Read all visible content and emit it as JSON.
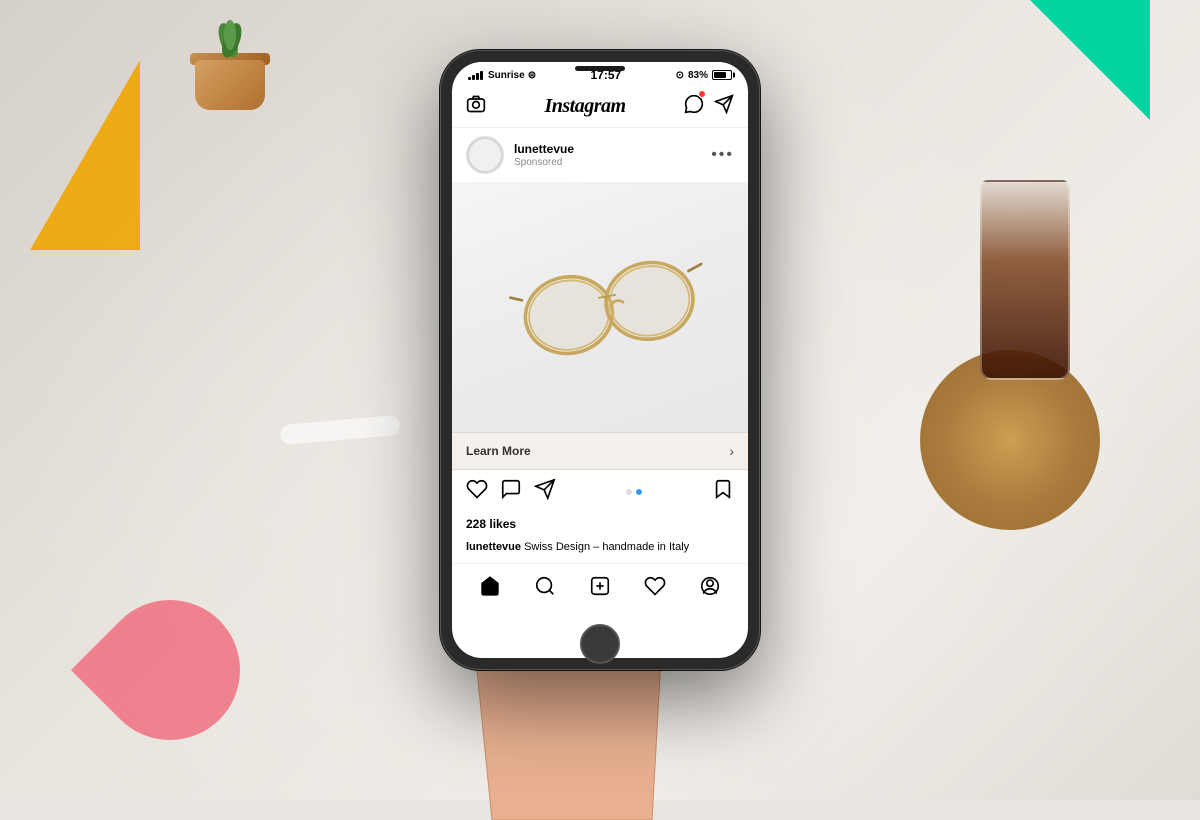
{
  "background": {
    "color": "#e8e4df"
  },
  "decorative": {
    "orange_triangle": "orange-triangle",
    "green_rectangle": "green-rectangle",
    "pink_shape": "pink-shape"
  },
  "phone": {
    "status_bar": {
      "carrier": "Sunrise",
      "wifi_symbol": "⊕",
      "time": "17:57",
      "location_icon": "⊙",
      "battery_percent": "83%"
    },
    "header": {
      "camera_icon": "📷",
      "logo": "Instagram",
      "direct_icon": "✈",
      "notification_count": "1"
    },
    "post": {
      "username": "lunettevue",
      "sponsored_label": "Sponsored",
      "menu_dots": "···",
      "image_alt": "Gold rimmed glasses on white background",
      "learn_more_label": "Learn More",
      "learn_more_arrow": "›",
      "likes_count": "228 likes",
      "caption_username": "lunettevue",
      "caption_text": " Swiss Design – handmade in Italy",
      "action_icons": {
        "heart": "♡",
        "comment": "💬",
        "share": "✈",
        "bookmark": "🔖"
      },
      "carousel_dots": [
        {
          "active": false
        },
        {
          "active": true
        }
      ]
    },
    "bottom_nav": {
      "home": "⌂",
      "search": "🔍",
      "plus": "⊕",
      "heart": "♡",
      "profile": "○"
    }
  }
}
